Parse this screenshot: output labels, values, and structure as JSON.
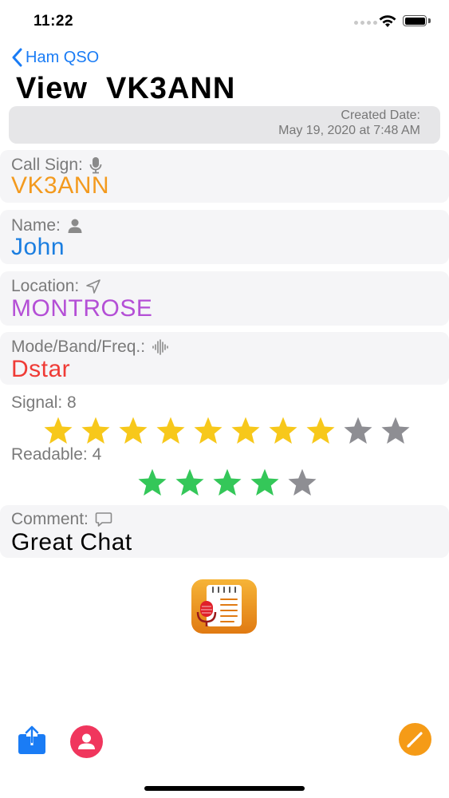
{
  "status": {
    "time": "11:22"
  },
  "nav": {
    "back_label": "Ham QSO",
    "title": "View  VK3ANN"
  },
  "created": {
    "label": "Created Date:",
    "value": "May 19, 2020 at 7:48 AM"
  },
  "fields": {
    "callsign": {
      "label": "Call Sign:",
      "value": "VK3ANN",
      "color": "#f39a1e",
      "icon": "microphone-icon"
    },
    "name": {
      "label": "Name:",
      "value": "John",
      "color": "#1b7ee0",
      "icon": "person-icon"
    },
    "location": {
      "label": "Location:",
      "value": "MONTROSE",
      "color": "#b44fd6",
      "icon": "location-arrow-icon"
    },
    "mode": {
      "label": "Mode/Band/Freq.:",
      "value": "Dstar",
      "color": "#ef3b36",
      "icon": "waveform-icon"
    },
    "comment": {
      "label": "Comment:",
      "value": "Great Chat",
      "color": "#000000",
      "icon": "speech-bubble-icon"
    }
  },
  "signal": {
    "label": "Signal: 8",
    "rating": 8,
    "max": 10,
    "on_color": "#f7c81b",
    "off_color": "#8e8e93"
  },
  "readable": {
    "label": "Readable: 4",
    "rating": 4,
    "max": 5,
    "on_color": "#34c759",
    "off_color": "#8e8e93"
  },
  "toolbar": {
    "share_icon": "share-icon",
    "profile_icon": "person-circle-icon",
    "edit_icon": "pencil-icon"
  },
  "colors": {
    "accent": "#1a7cf5",
    "card_bg": "#f5f5f7"
  }
}
